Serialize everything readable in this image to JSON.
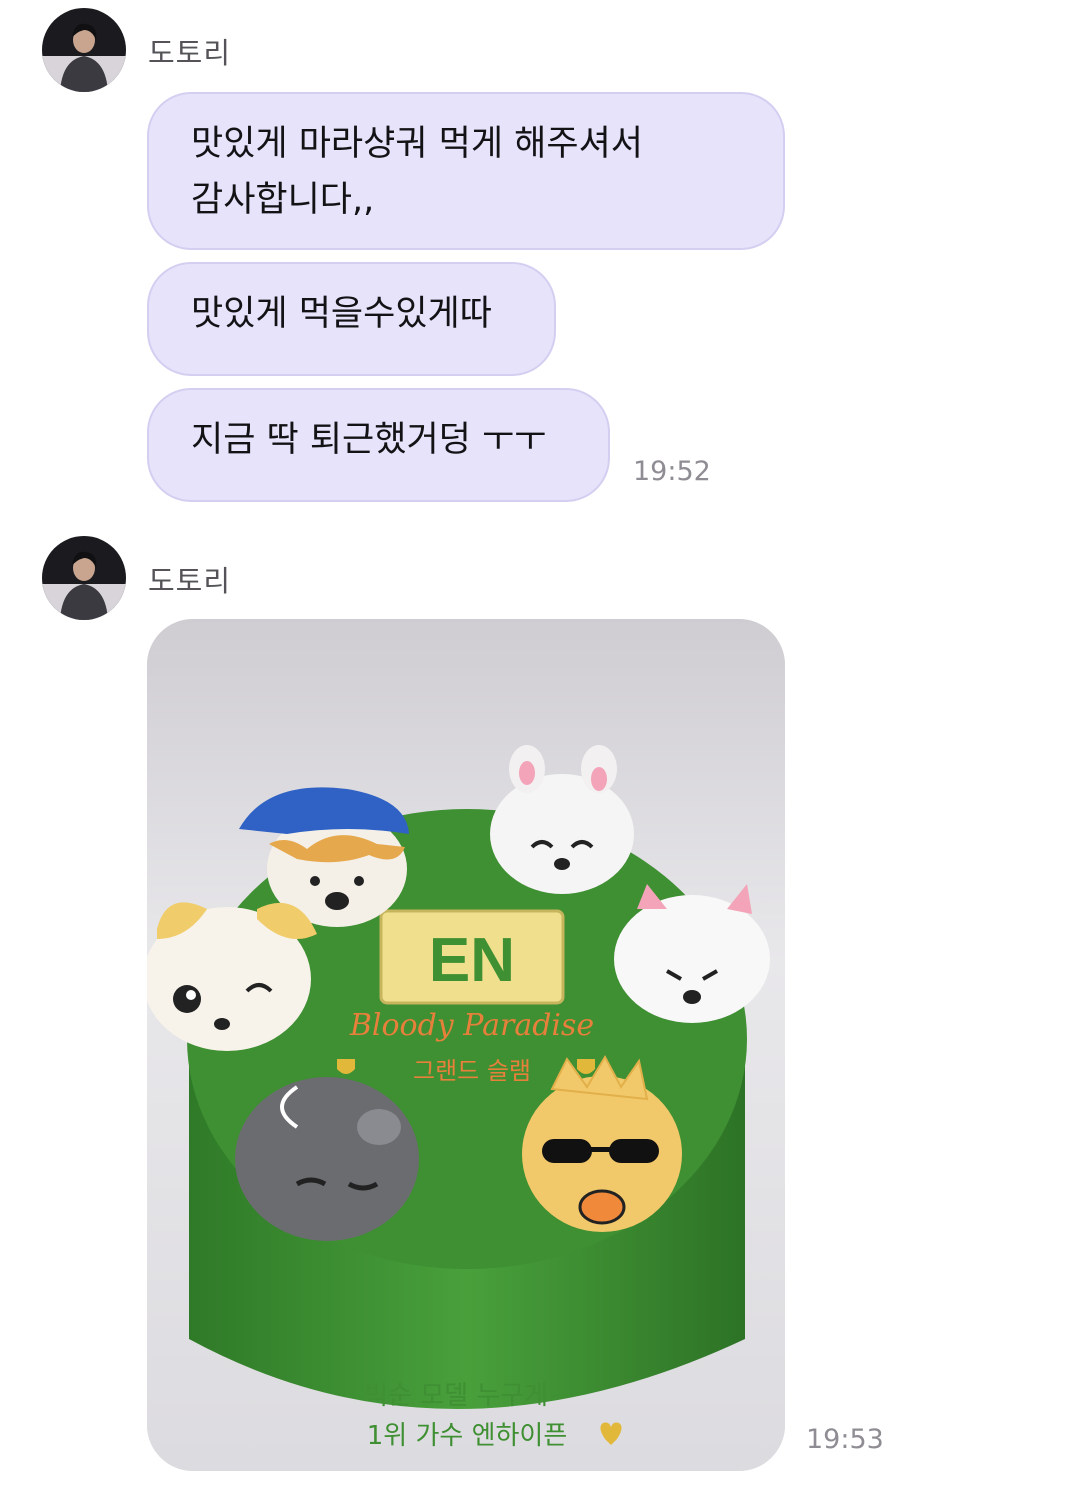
{
  "messages": [
    {
      "sender": "도토리",
      "bubbles": [
        {
          "line1": "맛있게 마라샹궈 먹게 해주셔서",
          "line2": "감사합니다,,"
        },
        {
          "text": "맛있게 먹을수있게따"
        },
        {
          "text": "지금 딱 퇴근했거덩 ㅜㅜ"
        }
      ],
      "time": "19:52"
    },
    {
      "sender": "도토리",
      "image": {
        "kind": "photo",
        "subject": "green-cake-with-character-figures",
        "cake_text": {
          "plaque": "EN",
          "title": "Bloody Paradise",
          "subtitle": "그랜드 슬램",
          "bottom_line1": "빅순 모델 누구게~",
          "bottom_line2": "1위 가수 엔하이픈"
        }
      },
      "time": "19:53"
    }
  ],
  "colors": {
    "bubble_bg": "#e6e3fb",
    "bubble_border": "#d4cff1",
    "time_text": "#8f8d93",
    "sender_text": "#555358",
    "cake_green": "#3f8f33"
  },
  "icons": {
    "avatar": "profile-photo-person"
  }
}
